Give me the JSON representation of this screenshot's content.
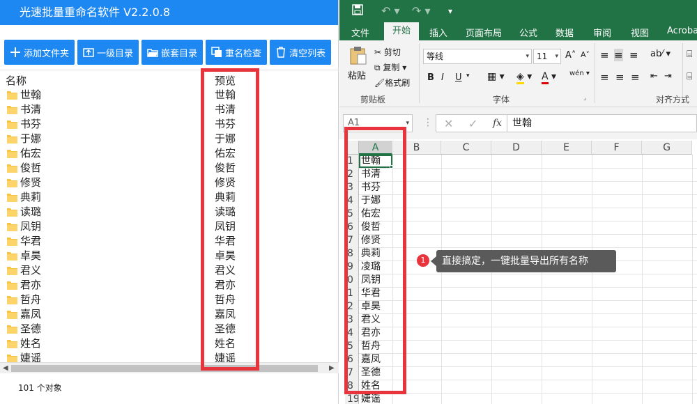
{
  "left_app": {
    "title": "光速批量重命名软件 V2.2.0.8",
    "toolbar": [
      {
        "label": "添加文件夹",
        "icon": "plus-icon"
      },
      {
        "label": "一级目录",
        "icon": "folder-up-icon"
      },
      {
        "label": "嵌套目录",
        "icon": "folder-open-icon"
      },
      {
        "label": "重名检查",
        "icon": "duplicate-check-icon"
      },
      {
        "label": "清空列表",
        "icon": "trash-icon"
      }
    ],
    "columns": {
      "name": "名称",
      "preview": "预览"
    },
    "rows": [
      {
        "name": "世翰",
        "preview": "世翰"
      },
      {
        "name": "书清",
        "preview": "书清"
      },
      {
        "name": "书芬",
        "preview": "书芬"
      },
      {
        "name": "于娜",
        "preview": "于娜"
      },
      {
        "name": "佑宏",
        "preview": "佑宏"
      },
      {
        "name": "俊哲",
        "preview": "俊哲"
      },
      {
        "name": "修贤",
        "preview": "修贤"
      },
      {
        "name": "典莉",
        "preview": "典莉"
      },
      {
        "name": "读璐",
        "preview": "读璐"
      },
      {
        "name": "凤钥",
        "preview": "凤钥"
      },
      {
        "name": "华君",
        "preview": "华君"
      },
      {
        "name": "卓昊",
        "preview": "卓昊"
      },
      {
        "name": "君义",
        "preview": "君义"
      },
      {
        "name": "君亦",
        "preview": "君亦"
      },
      {
        "name": "哲舟",
        "preview": "哲舟"
      },
      {
        "name": "嘉凤",
        "preview": "嘉凤"
      },
      {
        "name": "圣德",
        "preview": "圣德"
      },
      {
        "name": "姓名",
        "preview": "姓名"
      },
      {
        "name": "婕谣",
        "preview": "婕谣"
      }
    ],
    "status": "101 个对象",
    "accent": "#1e88f2"
  },
  "excel": {
    "tabs": [
      "文件",
      "开始",
      "插入",
      "页面布局",
      "公式",
      "数据",
      "审阅",
      "视图",
      "Acroba"
    ],
    "active_tab": "开始",
    "clipboard": {
      "paste": "粘贴",
      "cut": "剪切",
      "copy": "复制",
      "format_painter": "格式刷",
      "group": "剪贴板"
    },
    "font": {
      "name": "等线",
      "size": "11",
      "group": "字体",
      "bold": "B",
      "italic": "I",
      "underline": "U",
      "wen": "wén"
    },
    "align_group": "对齐方式",
    "name_box": "A1",
    "formula_value": "世翰",
    "fx": "fx",
    "col_headers": [
      "A",
      "B",
      "C",
      "D",
      "E",
      "F",
      "G"
    ],
    "row_numbers": [
      "1",
      "2",
      "3",
      "4",
      "5",
      "6",
      "7",
      "8",
      "9",
      "0",
      "1",
      "2",
      "3",
      "4",
      "5",
      "6",
      "7",
      "8",
      "19"
    ],
    "cells": [
      "世翰",
      "书清",
      "书芬",
      "于娜",
      "佑宏",
      "俊哲",
      "修贤",
      "典莉",
      "凌璐",
      "凤钥",
      "华君",
      "卓昊",
      "君义",
      "君亦",
      "哲舟",
      "嘉凤",
      "圣德",
      "姓名",
      "婕谣"
    ],
    "accent": "#217346"
  },
  "annotation": {
    "badge": "1",
    "text": "直接搞定，一键批量导出所有名称",
    "highlight_color": "#e8343c"
  }
}
